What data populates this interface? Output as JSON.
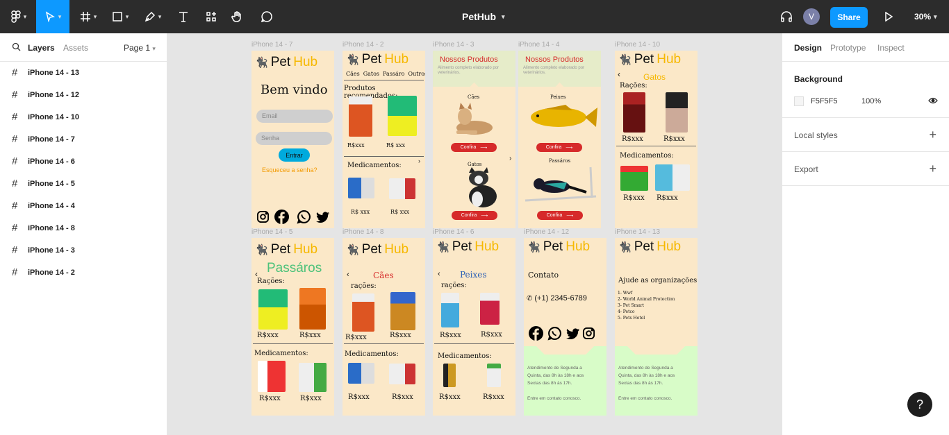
{
  "toolbar": {
    "file_title": "PetHub",
    "share_label": "Share",
    "avatar_initial": "V",
    "zoom": "30%"
  },
  "left_panel": {
    "tabs": [
      "Layers",
      "Assets"
    ],
    "page": "Page 1",
    "layers": [
      "iPhone 14 - 13",
      "iPhone 14 - 12",
      "iPhone 14 - 10",
      "iPhone 14 - 7",
      "iPhone 14 - 6",
      "iPhone 14 - 5",
      "iPhone 14 - 4",
      "iPhone 14 - 8",
      "iPhone 14 - 3",
      "iPhone 14 - 2"
    ]
  },
  "right_panel": {
    "tabs": [
      "Design",
      "Prototype",
      "Inspect"
    ],
    "background_label": "Background",
    "background_hex": "F5F5F5",
    "background_opacity": "100%",
    "local_styles": "Local styles",
    "export": "Export"
  },
  "canvas": {
    "frame_labels": {
      "f7": "iPhone 14 - 7",
      "f2": "iPhone 14 - 2",
      "f3": "iPhone 14 - 3",
      "f4": "iPhone 14 - 4",
      "f10": "iPhone 14 - 10",
      "f5": "iPhone 14 - 5",
      "f8": "iPhone 14 - 8",
      "f6": "iPhone 14 - 6",
      "f12": "iPhone 14 - 12",
      "f13": "iPhone 14 - 13"
    },
    "brand_a": "Pet",
    "brand_b": "Hub",
    "login": {
      "welcome": "Bem vindo",
      "email": "Email",
      "password": "Senha",
      "enter": "Entrar",
      "forgot": "Esqueceu a senha?"
    },
    "home": {
      "nav": [
        "Cães",
        "Gatos",
        "Passáro",
        "Outros"
      ],
      "recommended": "Produtos recomendados:",
      "price_a": "R$xxx",
      "price_b": "R$ xxx",
      "meds": "Medicamentos:",
      "meds_price": "R$ xxx"
    },
    "products": {
      "title": "Nossos Produtos",
      "subtitle": "Alimento completo elaborado por veterinários.",
      "dogs": "Cães",
      "cats": "Gatos",
      "fish": "Peixes",
      "birds": "Passáros",
      "cta": "Confira"
    },
    "cats": {
      "title": "Gatos",
      "rations": "Rações:",
      "price": "R$xxx",
      "meds": "Medicamentos:"
    },
    "birds": {
      "title": "Passáros",
      "rations": "Rações:",
      "price": "R$xxx",
      "meds": "Medicamentos:"
    },
    "dogs": {
      "title": "Cães",
      "rations": "rações:",
      "price": "R$xxx",
      "meds": "Medicamentos:"
    },
    "fish": {
      "title": "Peixes",
      "rations": "rações:",
      "price": "R$xxx",
      "meds": "Medicamentos:"
    },
    "contact": {
      "title": "Contato",
      "phone": "(+1) 2345-6789",
      "hours_1": "Atendimento de Segunda a Quinta, das 8h às 18h e aos Sextas das 8h às 17h.",
      "hours_2": "Entre em contato conosco."
    },
    "orgs": {
      "title": "Ajude as organizações",
      "items": [
        "1- Wwf",
        "2- World Animal Protection",
        "3- Pet Smart",
        "4- Petco",
        "5- Pets Hotel"
      ]
    }
  },
  "colors": {
    "accent": "#0d99ff",
    "frame_bg": "#fbe8c8",
    "brand_yellow": "#f6b800",
    "cta_red": "#d62a2a",
    "toolbar": "#2c2c2c"
  }
}
